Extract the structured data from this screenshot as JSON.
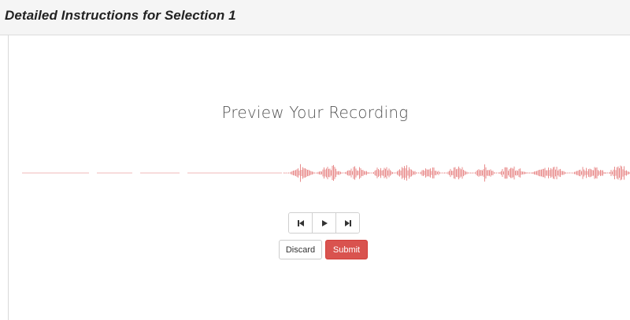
{
  "header": {
    "title": "Detailed Instructions for Selection 1"
  },
  "preview": {
    "title": "Preview Your Recording"
  },
  "waveform": {
    "color": "#e06666",
    "baseline_color": "#f0b8b8"
  },
  "transport": {
    "buttons": [
      {
        "icon": "skip-back-icon"
      },
      {
        "icon": "play-icon"
      },
      {
        "icon": "skip-forward-icon"
      }
    ]
  },
  "actions": {
    "discard_label": "Discard",
    "submit_label": "Submit",
    "submit_color": "#d9534f"
  }
}
